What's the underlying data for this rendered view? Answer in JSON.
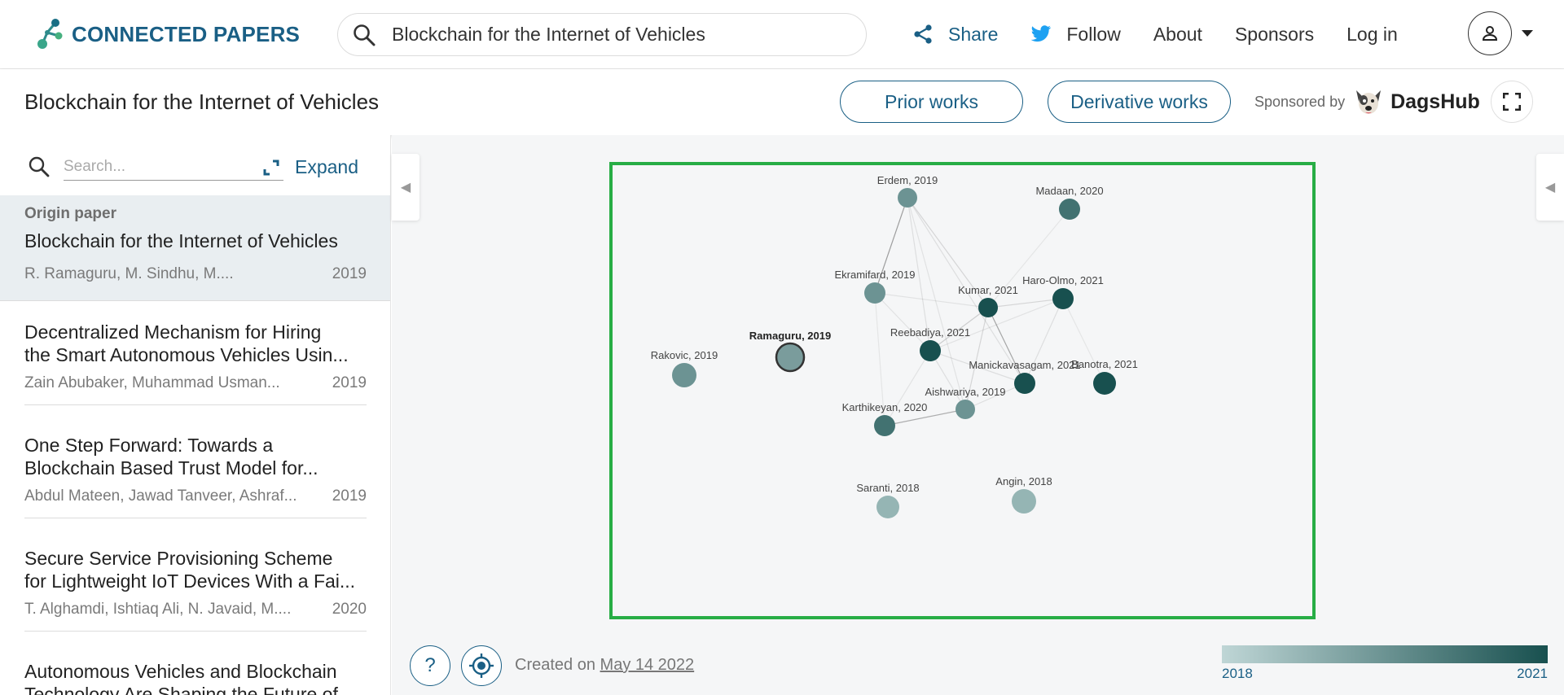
{
  "app": {
    "brand": "CONNECTED PAPERS",
    "search_query": "Blockchain for the Internet of Vehicles",
    "nav": {
      "share": "Share",
      "follow": "Follow",
      "about": "About",
      "sponsors": "Sponsors",
      "login": "Log in"
    }
  },
  "header": {
    "title": "Blockchain for the Internet of Vehicles",
    "prior_works": "Prior works",
    "derivative_works": "Derivative works",
    "sponsored_by": "Sponsored by",
    "sponsor_name": "DagsHub"
  },
  "sidebar": {
    "search_placeholder": "Search...",
    "expand": "Expand",
    "origin": {
      "label": "Origin paper",
      "title": "Blockchain for the Internet of Vehicles",
      "authors": "R. Ramaguru, M. Sindhu, M....",
      "year": "2019"
    },
    "papers": [
      {
        "title_l1": "Decentralized Mechanism for Hiring",
        "title_l2": "the Smart Autonomous Vehicles Usin...",
        "authors": "Zain Abubaker, Muhammad Usman...",
        "year": "2019"
      },
      {
        "title_l1": "One Step Forward: Towards a",
        "title_l2": "Blockchain Based Trust Model for...",
        "authors": "Abdul Mateen, Jawad Tanveer, Ashraf...",
        "year": "2019"
      },
      {
        "title_l1": "Secure Service Provisioning Scheme",
        "title_l2": "for Lightweight IoT Devices With a Fai...",
        "authors": "T. Alghamdi, Ishtiaq Ali, N. Javaid, M....",
        "year": "2020"
      },
      {
        "title_l1": "Autonomous Vehicles and Blockchain",
        "title_l2": "Technology Are Shaping the Future of...",
        "authors": "",
        "year": ""
      }
    ]
  },
  "graph": {
    "nodes": [
      {
        "id": "erdem",
        "label": "Erdem, 2019",
        "year": 2019
      },
      {
        "id": "madaan",
        "label": "Madaan, 2020",
        "year": 2020
      },
      {
        "id": "ekramifard",
        "label": "Ekramifard, 2019",
        "year": 2019
      },
      {
        "id": "kumar",
        "label": "Kumar, 2021",
        "year": 2021
      },
      {
        "id": "haroolmo",
        "label": "Haro-Olmo, 2021",
        "year": 2021
      },
      {
        "id": "ramaguru",
        "label": "Ramaguru, 2019",
        "year": 2019,
        "origin": true
      },
      {
        "id": "reebadiya",
        "label": "Reebadiya, 2021",
        "year": 2021
      },
      {
        "id": "rakovic",
        "label": "Rakovic, 2019",
        "year": 2019
      },
      {
        "id": "manickavasagam",
        "label": "Manickavasagam, 2021",
        "year": 2021
      },
      {
        "id": "banotra",
        "label": "Banotra, 2021",
        "year": 2021
      },
      {
        "id": "aishwariya",
        "label": "Aishwariya, 2019",
        "year": 2019
      },
      {
        "id": "karthikeyan",
        "label": "Karthikeyan, 2020",
        "year": 2020
      },
      {
        "id": "saranti",
        "label": "Saranti, 2018",
        "year": 2018
      },
      {
        "id": "angin",
        "label": "Angin, 2018",
        "year": 2018
      }
    ],
    "colors": {
      "oldest": "#bfd6d6",
      "newest": "#18504f",
      "frame": "#27ad45",
      "accent": "#1a5f85"
    }
  },
  "footer": {
    "created_prefix": "Created on",
    "created_date": "May 14 2022",
    "legend_min": "2018",
    "legend_max": "2021",
    "help": "?"
  }
}
